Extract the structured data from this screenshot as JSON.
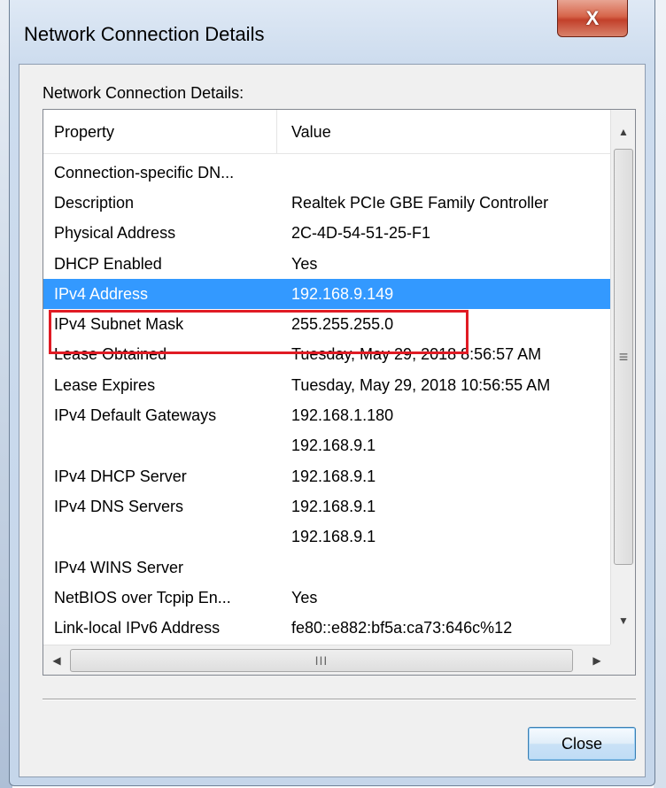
{
  "window": {
    "title": "Network Connection Details",
    "close_glyph": "X"
  },
  "group": {
    "label": "Network Connection Details:"
  },
  "columns": {
    "property": "Property",
    "value": "Value"
  },
  "rows": [
    {
      "property": "Connection-specific DN...",
      "value": ""
    },
    {
      "property": "Description",
      "value": "Realtek PCIe GBE Family Controller"
    },
    {
      "property": "Physical Address",
      "value": "2C-4D-54-51-25-F1"
    },
    {
      "property": "DHCP Enabled",
      "value": "Yes"
    },
    {
      "property": "IPv4 Address",
      "value": "192.168.9.149",
      "selected": true
    },
    {
      "property": "IPv4 Subnet Mask",
      "value": "255.255.255.0"
    },
    {
      "property": "Lease Obtained",
      "value": "Tuesday, May 29, 2018 8:56:57 AM"
    },
    {
      "property": "Lease Expires",
      "value": "Tuesday, May 29, 2018 10:56:55 AM"
    },
    {
      "property": "IPv4 Default Gateways",
      "value": "192.168.1.180"
    },
    {
      "property": "",
      "value": "192.168.9.1"
    },
    {
      "property": "IPv4 DHCP Server",
      "value": "192.168.9.1"
    },
    {
      "property": "IPv4 DNS Servers",
      "value": "192.168.9.1"
    },
    {
      "property": "",
      "value": "192.168.9.1"
    },
    {
      "property": "IPv4 WINS Server",
      "value": ""
    },
    {
      "property": "NetBIOS over Tcpip En...",
      "value": "Yes"
    },
    {
      "property": "Link-local IPv6 Address",
      "value": "fe80::e882:bf5a:ca73:646c%12"
    }
  ],
  "scrollbars": {
    "vertical_grip": "≡",
    "horizontal_grip": "III",
    "up_arrow": "▲",
    "down_arrow": "▼",
    "left_arrow": "◀",
    "right_arrow": "▶"
  },
  "buttons": {
    "close_label": "Close"
  },
  "colors": {
    "selection": "#3399ff",
    "highlight_box": "#e01b24"
  }
}
